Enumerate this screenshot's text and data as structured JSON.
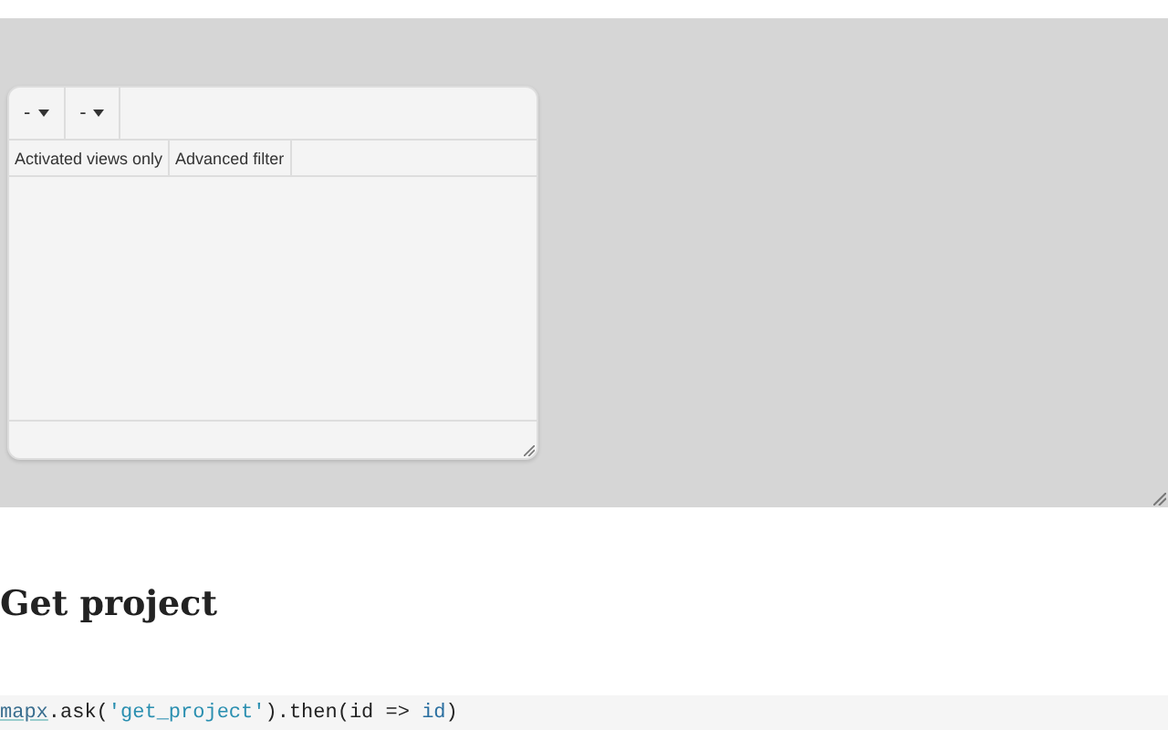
{
  "panel": {
    "dropdowns": [
      {
        "label": "-"
      },
      {
        "label": "-"
      }
    ],
    "filters": [
      {
        "label": "Activated views only"
      },
      {
        "label": "Advanced filter"
      }
    ]
  },
  "heading": "Get project",
  "code": [
    {
      "kind": "object",
      "text": "mapx"
    },
    {
      "kind": "plain",
      "text": ".ask("
    },
    {
      "kind": "string",
      "text": "'get_project'"
    },
    {
      "kind": "plain",
      "text": ").then(id => "
    },
    {
      "kind": "variable",
      "text": "id"
    },
    {
      "kind": "plain",
      "text": ")"
    }
  ]
}
